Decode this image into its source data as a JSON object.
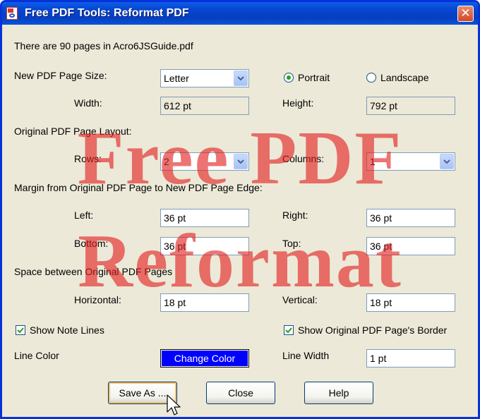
{
  "window": {
    "title": "Free PDF Tools: Reformat PDF",
    "close_glyph": "✕"
  },
  "info": {
    "text": "There are 90 pages in Acro6JSGuide.pdf"
  },
  "page_size": {
    "label": "New PDF Page Size:",
    "selected": "Letter",
    "portrait_label": "Portrait",
    "landscape_label": "Landscape",
    "orientation": "portrait",
    "width_label": "Width:",
    "width_value": "612 pt",
    "height_label": "Height:",
    "height_value": "792 pt"
  },
  "layout": {
    "label": "Original PDF Page Layout:",
    "rows_label": "Rows:",
    "rows_value": "2",
    "columns_label": "Columns:",
    "columns_value": "1"
  },
  "margins": {
    "label": "Margin from Original PDF Page to New PDF Page Edge:",
    "left_label": "Left:",
    "left_value": "36 pt",
    "right_label": "Right:",
    "right_value": "36 pt",
    "bottom_label": "Bottom:",
    "bottom_value": "36 pt",
    "top_label": "Top:",
    "top_value": "36 pt"
  },
  "spacing": {
    "label": "Space between Original PDF Pages",
    "horizontal_label": "Horizontal:",
    "horizontal_value": "18 pt",
    "vertical_label": "Vertical:",
    "vertical_value": "18 pt"
  },
  "options": {
    "show_note_lines_label": "Show Note Lines",
    "show_note_lines_checked": true,
    "show_border_label": "Show Original PDF Page's Border",
    "show_border_checked": true,
    "line_color_label": "Line Color",
    "change_color_label": "Change Color",
    "line_color_value": "#0000ff",
    "line_width_label": "Line Width",
    "line_width_value": "1 pt"
  },
  "buttons": {
    "save_as": "Save As ...",
    "close": "Close",
    "help": "Help"
  },
  "watermark": {
    "line1": "Free PDF",
    "line2": "Reformat",
    "color": "#e21e1e"
  },
  "icons": {
    "app": "app-icon",
    "close": "close-icon",
    "dropdown": "chevron-down-icon",
    "cursor": "mouse-cursor-icon"
  }
}
